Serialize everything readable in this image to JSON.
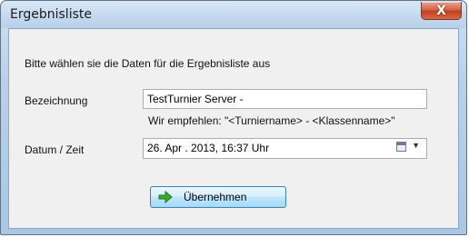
{
  "window": {
    "title": "Ergebnisliste",
    "close_label": "X"
  },
  "dialog": {
    "instruction": "Bitte wählen sie die Daten für die Ergebnisliste aus",
    "bezeichnung_label": "Bezeichnung",
    "bezeichnung_value": "TestTurnier Server -",
    "hint": "Wir empfehlen: \"<Turniername> - <Klassenname>\"",
    "datum_label": "Datum / Zeit",
    "datum_value": "26. Apr . 2013, 16:37 Uhr",
    "apply_label": "Übernehmen"
  },
  "icons": {
    "close": "close-icon",
    "calendar": "calendar-icon",
    "dropdown": "chevron-down-icon",
    "apply": "green-arrow-right-icon"
  },
  "colors": {
    "apply_icon": "#3caa2e",
    "close_button": "#c2401f"
  }
}
